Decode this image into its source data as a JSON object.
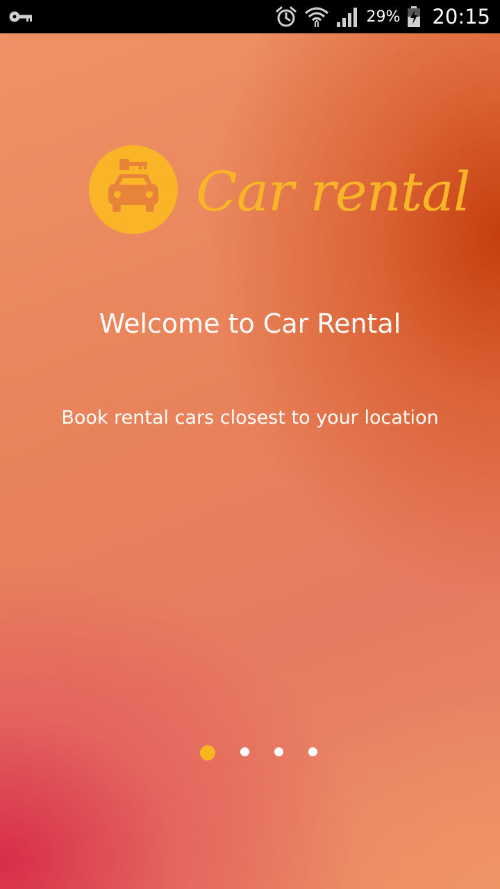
{
  "status_bar": {
    "battery_percent": "29%",
    "time": "20:15",
    "icons": [
      "key-icon",
      "alarm-icon",
      "wifi-icon",
      "signal-icon",
      "battery-charging-icon"
    ]
  },
  "logo": {
    "text": "Car rental",
    "icon": "car-key-icon",
    "color": "#f9b428"
  },
  "onboarding": {
    "title": "Welcome to Car Rental",
    "subtitle": "Book rental cars closest to your location",
    "page_count": 4,
    "active_page": 1,
    "active_dot_color": "#f9b71f",
    "inactive_dot_color": "#ffffff"
  }
}
